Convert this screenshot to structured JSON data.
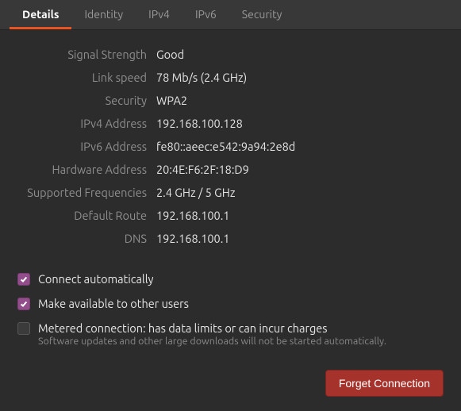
{
  "tabs": {
    "details": "Details",
    "identity": "Identity",
    "ipv4": "IPv4",
    "ipv6": "IPv6",
    "security": "Security"
  },
  "details": {
    "signal_strength": {
      "label": "Signal Strength",
      "value": "Good"
    },
    "link_speed": {
      "label": "Link speed",
      "value": "78 Mb/s (2.4 GHz)"
    },
    "security": {
      "label": "Security",
      "value": "WPA2"
    },
    "ipv4_address": {
      "label": "IPv4 Address",
      "value": "192.168.100.128"
    },
    "ipv6_address": {
      "label": "IPv6 Address",
      "value": "fe80::aeec:e542:9a94:2e8d"
    },
    "hardware_address": {
      "label": "Hardware Address",
      "value": "20:4E:F6:2F:18:D9"
    },
    "supported_frequencies": {
      "label": "Supported Frequencies",
      "value": "2.4 GHz / 5 GHz"
    },
    "default_route": {
      "label": "Default Route",
      "value": "192.168.100.1"
    },
    "dns": {
      "label": "DNS",
      "value": "192.168.100.1"
    }
  },
  "options": {
    "connect_auto": {
      "label": "Connect automatically",
      "checked": true
    },
    "available_others": {
      "label": "Make available to other users",
      "checked": true
    },
    "metered": {
      "label": "Metered connection: has data limits or can incur charges",
      "sublabel": "Software updates and other large downloads will not be started automatically.",
      "checked": false
    }
  },
  "buttons": {
    "forget": "Forget Connection"
  },
  "colors": {
    "accent": "#e95420",
    "checkbox_checked": "#924d8b",
    "danger": "#a6322c"
  }
}
